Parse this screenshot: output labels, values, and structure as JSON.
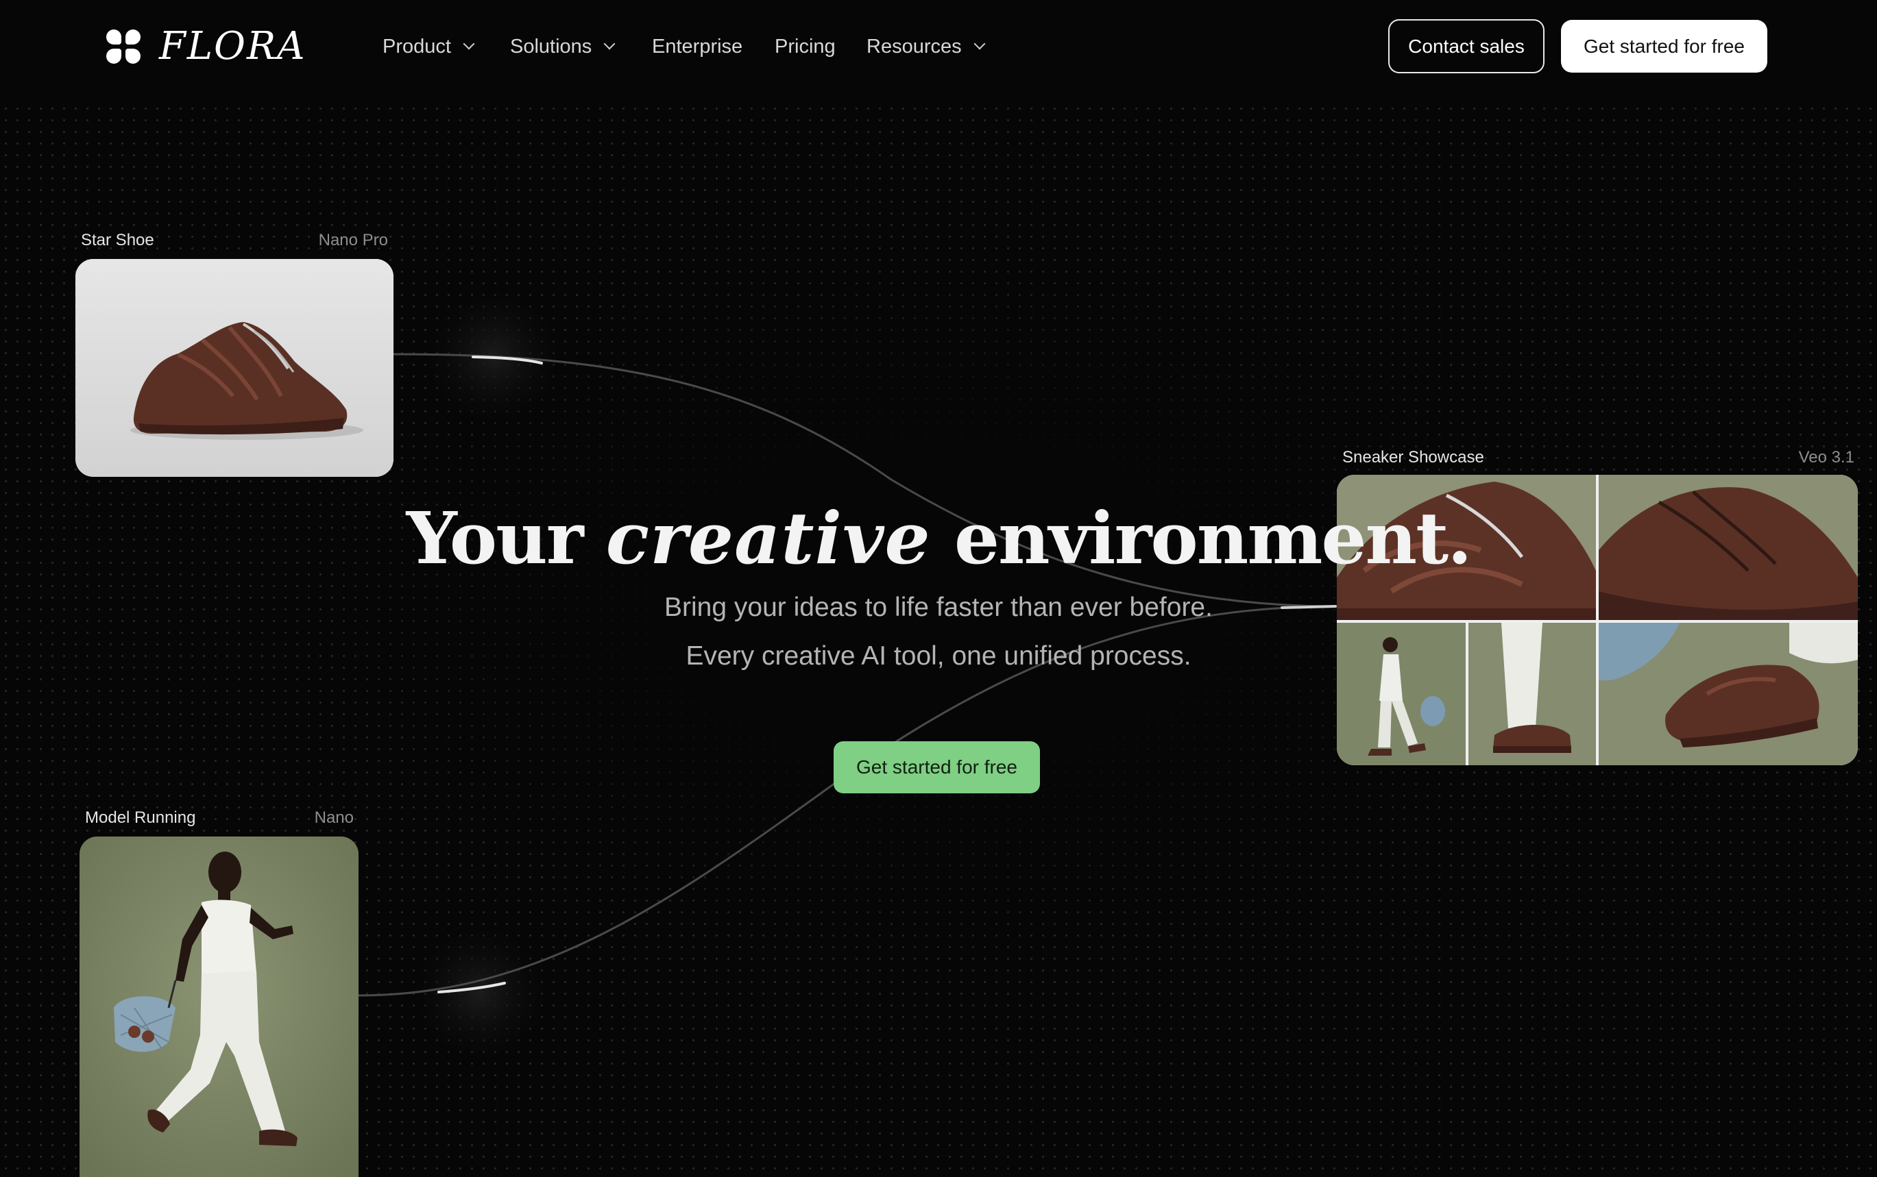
{
  "nav": {
    "brand": "FLORA",
    "items": [
      {
        "label": "Product",
        "has_dropdown": true
      },
      {
        "label": "Solutions",
        "has_dropdown": true
      },
      {
        "label": "Enterprise",
        "has_dropdown": false
      },
      {
        "label": "Pricing",
        "has_dropdown": false
      },
      {
        "label": "Resources",
        "has_dropdown": true
      }
    ],
    "contact_label": "Contact sales",
    "cta_label": "Get started for free"
  },
  "hero": {
    "title_start": "Your",
    "title_emphasis": "creative",
    "title_end": "environment.",
    "subtitle_line1": "Bring your ideas to life faster than ever before.",
    "subtitle_line2": "Every creative AI tool, one unified process.",
    "cta_label": "Get started for free",
    "cta_color": "#7fcf84"
  },
  "nodes": [
    {
      "label": "Star Shoe",
      "model": "Nano Pro",
      "content": "brown sneaker on white background"
    },
    {
      "label": "Sneaker Showcase",
      "model": "Veo 3.1",
      "content": "grid of sneaker shots"
    },
    {
      "label": "Model Running",
      "model": "Nano",
      "content": "model running in white outfit"
    }
  ],
  "theme": {
    "background": "#060606",
    "dot_grid": true
  }
}
